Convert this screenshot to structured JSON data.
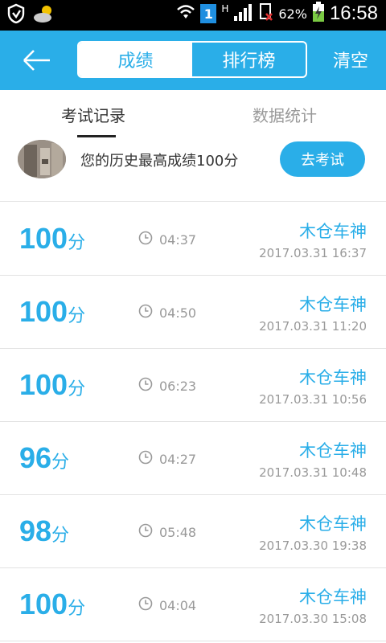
{
  "status_bar": {
    "battery_percent": "62%",
    "time": "16:58",
    "sim_label": "1",
    "network_label": "H"
  },
  "header": {
    "back_icon": "back-arrow-icon",
    "segments": [
      {
        "label": "成绩",
        "active": true
      },
      {
        "label": "排行榜",
        "active": false
      }
    ],
    "clear_label": "清空"
  },
  "subtabs": [
    {
      "label": "考试记录",
      "active": true
    },
    {
      "label": "数据统计",
      "active": false
    }
  ],
  "best": {
    "text": "您的历史最高成绩100分",
    "button_label": "去考试"
  },
  "records": [
    {
      "score": "100",
      "unit": "分",
      "duration": "04:37",
      "name": "木仓车神",
      "time": "2017.03.31  16:37"
    },
    {
      "score": "100",
      "unit": "分",
      "duration": "04:50",
      "name": "木仓车神",
      "time": "2017.03.31  11:20"
    },
    {
      "score": "100",
      "unit": "分",
      "duration": "06:23",
      "name": "木仓车神",
      "time": "2017.03.31  10:56"
    },
    {
      "score": "96",
      "unit": "分",
      "duration": "04:27",
      "name": "木仓车神",
      "time": "2017.03.31  10:48"
    },
    {
      "score": "98",
      "unit": "分",
      "duration": "05:48",
      "name": "木仓车神",
      "time": "2017.03.30  19:38"
    },
    {
      "score": "100",
      "unit": "分",
      "duration": "04:04",
      "name": "木仓车神",
      "time": "2017.03.30  15:08"
    }
  ],
  "colors": {
    "accent": "#2aaee8",
    "text_dark": "#333333",
    "text_muted": "#999999"
  }
}
